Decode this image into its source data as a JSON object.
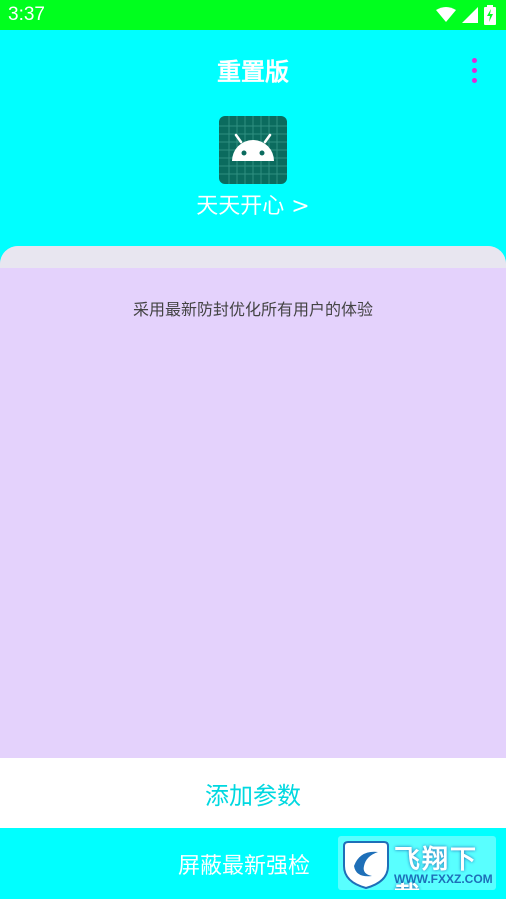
{
  "status_bar": {
    "time": "3:37",
    "icons": [
      "wifi-icon",
      "signal-icon",
      "battery-icon"
    ]
  },
  "toolbar": {
    "title": "重置版",
    "menu_icon": "more-vertical-icon"
  },
  "app": {
    "name": "天天开心 >",
    "icon": "android-icon"
  },
  "card": {
    "description": "采用最新防封优化所有用户的体验"
  },
  "add_param": {
    "label": "添加参数"
  },
  "shield": {
    "label": "屏蔽最新强检"
  },
  "watermark": {
    "logo_text": "飞翔下载",
    "url": "WWW.FXXZ.COM"
  },
  "colors": {
    "status_bar": "#00ff1e",
    "background": "#00ffff",
    "card": "#e4d2fc",
    "accent_text": "#00d8e0",
    "menu_dots": "#e02bd8"
  }
}
